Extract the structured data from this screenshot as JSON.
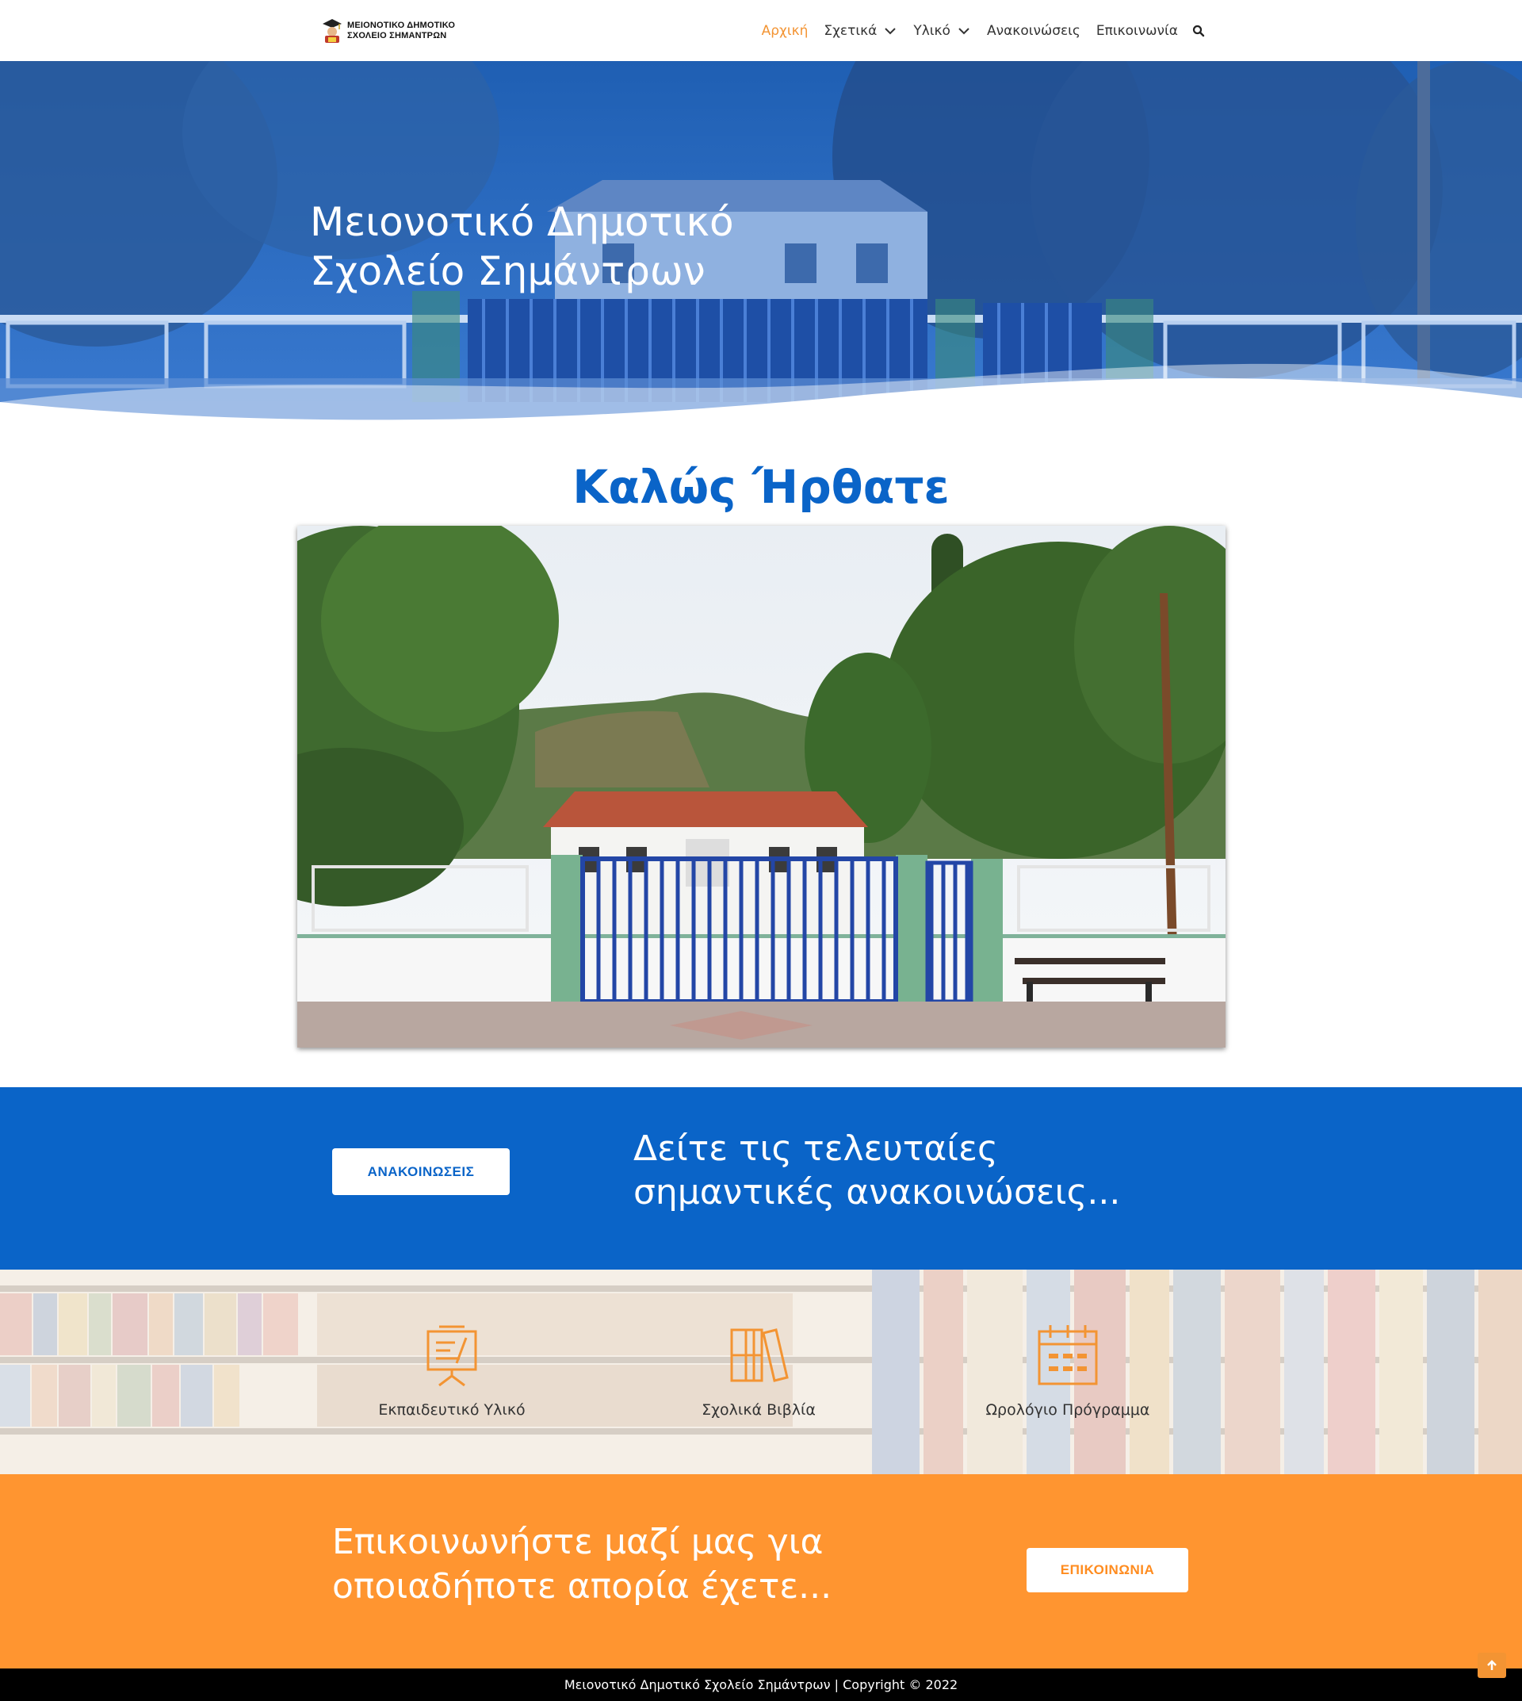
{
  "header": {
    "logo_line1": "ΜΕΙΟΝΟΤΙΚΟ ΔΗΜΟΤΙΚΟ",
    "logo_line2": "ΣΧΟΛΕΙΟ ΣΗΜΑΝΤΡΩΝ",
    "nav": [
      {
        "label": "Αρχική",
        "active": true
      },
      {
        "label": "Σχετικά",
        "has_dropdown": true
      },
      {
        "label": "Υλικό",
        "has_dropdown": true
      },
      {
        "label": "Ανακοινώσεις"
      },
      {
        "label": "Επικοινωνία"
      }
    ],
    "search_icon": "search-icon"
  },
  "hero": {
    "title_line1": "Μειονοτικό Δημοτικό",
    "title_line2": "Σχολείο Σημάντρων"
  },
  "welcome": {
    "title": "Καλώς Ήρθατε"
  },
  "announcements": {
    "button_label": "ΑΝΑΚΟΙΝΩΣΕΙΣ",
    "text_line1": "Δείτε τις τελευταίες",
    "text_line2": "σημαντικές ανακοινώσεις..."
  },
  "resources": [
    {
      "label": "Εκπαιδευτικό Υλικό",
      "icon": "presentation-board-icon"
    },
    {
      "label": "Σχολικά Βιβλία",
      "icon": "books-icon"
    },
    {
      "label": "Ωρολόγιο Πρόγραμμα",
      "icon": "calendar-icon"
    }
  ],
  "contact": {
    "text_line1": "Επικοινωνήστε μαζί μας για",
    "text_line2": "οποιαδήποτε απορία έχετε...",
    "button_label": "ΕΠΙΚΟΙΝΩΝΙΑ"
  },
  "footer": {
    "text": "Μειονοτικό Δημοτικό Σχολείο Σημάντρων | Copyright © 2022"
  },
  "colors": {
    "brand_blue": "#0a64c8",
    "accent_orange": "#ff9530",
    "nav_active": "#f39433"
  }
}
